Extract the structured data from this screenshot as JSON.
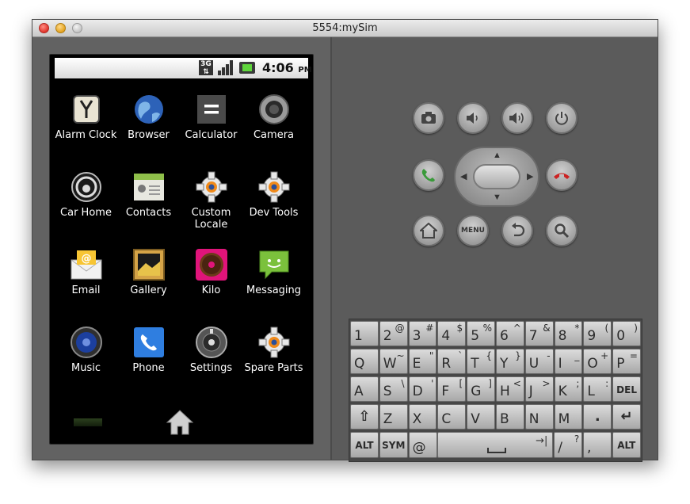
{
  "window": {
    "title": "5554:mySim"
  },
  "statusbar": {
    "network": "3G",
    "time": "4:06",
    "ampm": "PM"
  },
  "apps": [
    {
      "label": "Alarm Clock",
      "icon": "alarm-clock-icon"
    },
    {
      "label": "Browser",
      "icon": "globe-icon"
    },
    {
      "label": "Calculator",
      "icon": "calculator-icon"
    },
    {
      "label": "Camera",
      "icon": "camera-lens-icon"
    },
    {
      "label": "Car Home",
      "icon": "steering-wheel-icon"
    },
    {
      "label": "Contacts",
      "icon": "contacts-icon"
    },
    {
      "label": "Custom\nLocale",
      "icon": "gear-icon"
    },
    {
      "label": "Dev Tools",
      "icon": "gear-icon"
    },
    {
      "label": "Email",
      "icon": "envelope-icon"
    },
    {
      "label": "Gallery",
      "icon": "picture-frame-icon"
    },
    {
      "label": "Kilo",
      "icon": "donut-icon"
    },
    {
      "label": "Messaging",
      "icon": "speech-bubble-icon"
    },
    {
      "label": "Music",
      "icon": "speaker-icon"
    },
    {
      "label": "Phone",
      "icon": "phone-handset-icon"
    },
    {
      "label": "Settings",
      "icon": "settings-knob-icon"
    },
    {
      "label": "Spare Parts",
      "icon": "gear-icon"
    }
  ],
  "controls": {
    "menu_label": "MENU"
  },
  "keyboard": {
    "rows": [
      [
        [
          "1",
          ""
        ],
        [
          "2",
          "@"
        ],
        [
          "3",
          "#"
        ],
        [
          "4",
          "$"
        ],
        [
          "5",
          "%"
        ],
        [
          "6",
          "^"
        ],
        [
          "7",
          "&"
        ],
        [
          "8",
          "*"
        ],
        [
          "9",
          "("
        ],
        [
          "0",
          ")"
        ]
      ],
      [
        [
          "Q",
          ""
        ],
        [
          "W",
          "~"
        ],
        [
          "E",
          "\""
        ],
        [
          "R",
          "`"
        ],
        [
          "T",
          "{"
        ],
        [
          "Y",
          "}"
        ],
        [
          "U",
          "-"
        ],
        [
          "I",
          "_"
        ],
        [
          "O",
          "+"
        ],
        [
          "P",
          "="
        ]
      ],
      [
        [
          "A",
          ""
        ],
        [
          "S",
          "\\"
        ],
        [
          "D",
          "'"
        ],
        [
          "F",
          "["
        ],
        [
          "G",
          "]"
        ],
        [
          "H",
          "<"
        ],
        [
          "J",
          ">"
        ],
        [
          "K",
          ";"
        ],
        [
          "L",
          ":"
        ],
        [
          "DEL",
          ""
        ]
      ],
      [
        [
          "⇧",
          ""
        ],
        [
          "Z",
          ""
        ],
        [
          "X",
          ""
        ],
        [
          "C",
          ""
        ],
        [
          "V",
          ""
        ],
        [
          "B",
          ""
        ],
        [
          "N",
          ""
        ],
        [
          "M",
          ""
        ],
        [
          ".",
          ""
        ],
        [
          "↵",
          ""
        ]
      ]
    ],
    "bottom": {
      "alt_left": "ALT",
      "sym": "SYM",
      "at": "@",
      "slash": "/",
      "slash_sub": "?",
      "comma": ",",
      "alt_right": "ALT"
    }
  },
  "colors": {
    "call_green": "#3a9a3a",
    "end_red": "#cc2222",
    "battery_green": "#5fd53c"
  }
}
